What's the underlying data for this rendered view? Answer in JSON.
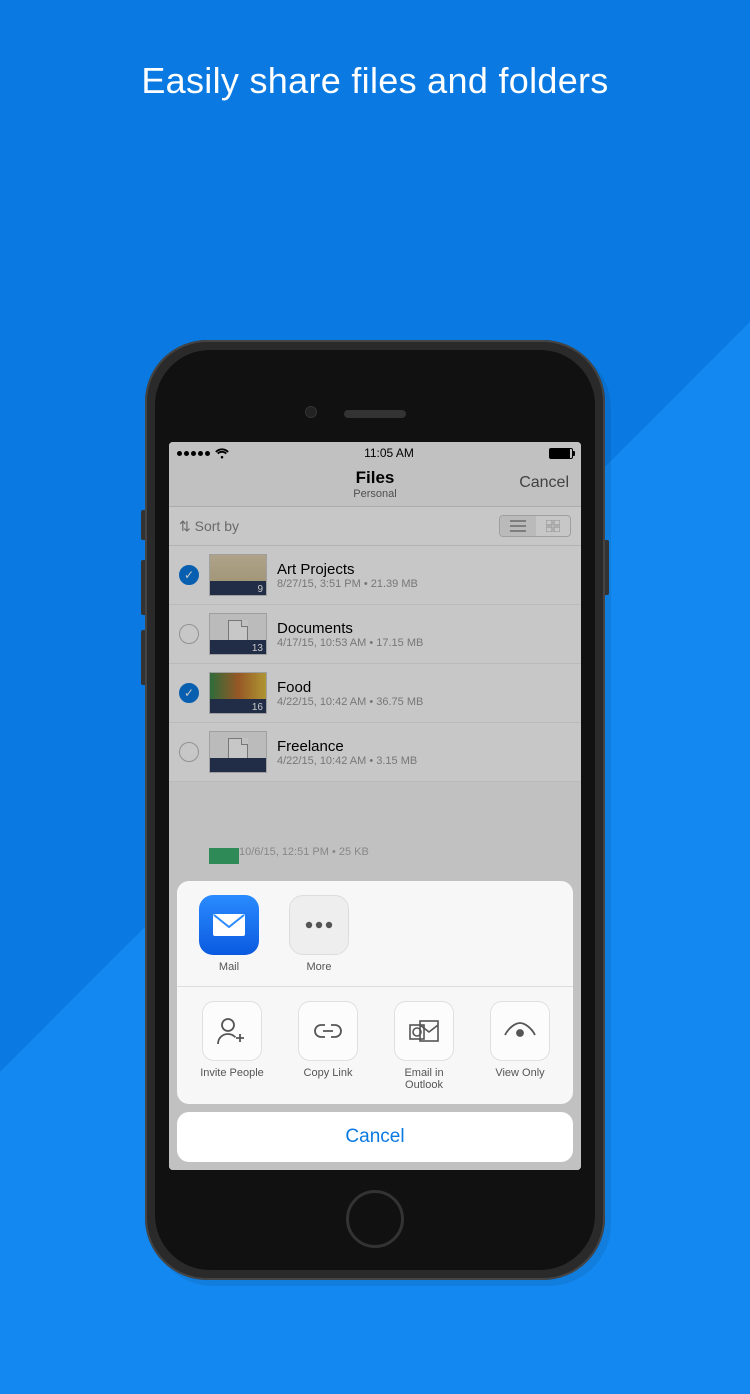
{
  "headline": "Easily share files and folders",
  "status": {
    "time": "11:05 AM"
  },
  "nav": {
    "title": "Files",
    "subtitle": "Personal",
    "cancel": "Cancel"
  },
  "sortbar": {
    "label": "Sort by"
  },
  "files": [
    {
      "selected": true,
      "title": "Art Projects",
      "meta": "8/27/15, 3:51 PM • 21.39 MB",
      "count": "9"
    },
    {
      "selected": false,
      "title": "Documents",
      "meta": "4/17/15, 10:53 AM • 17.15 MB",
      "count": "13"
    },
    {
      "selected": true,
      "title": "Food",
      "meta": "4/22/15, 10:42 AM • 36.75 MB",
      "count": "16"
    },
    {
      "selected": false,
      "title": "Freelance",
      "meta": "4/22/15, 10:42 AM • 3.15 MB",
      "count": ""
    }
  ],
  "peek_meta": "10/6/15, 12:51 PM • 25 KB",
  "share": {
    "apps": [
      {
        "id": "mail",
        "label": "Mail"
      },
      {
        "id": "more",
        "label": "More"
      }
    ],
    "actions": [
      {
        "id": "invite",
        "label": "Invite People"
      },
      {
        "id": "copy",
        "label": "Copy Link"
      },
      {
        "id": "outlook",
        "label": "Email in Outlook"
      },
      {
        "id": "view",
        "label": "View Only"
      }
    ],
    "cancel": "Cancel"
  }
}
